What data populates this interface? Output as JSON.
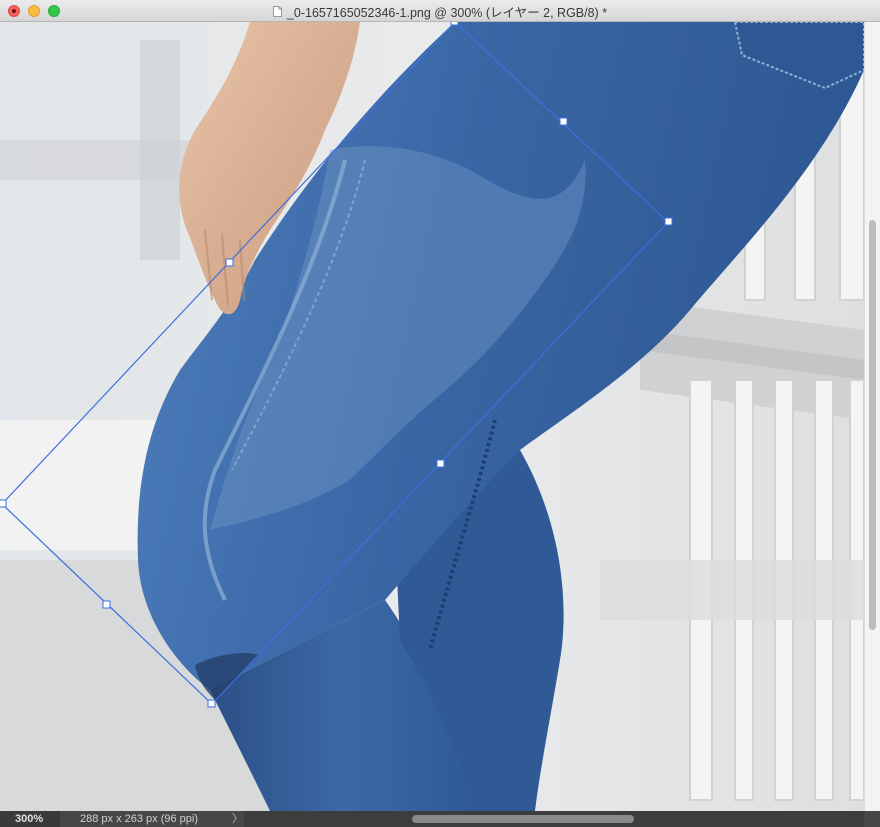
{
  "window": {
    "title": "_0-1657165052346-1.png @ 300% (レイヤー 2, RGB/8) *"
  },
  "status": {
    "zoom": "300%",
    "doc_info": "288 px x 263 px (96 ppi)",
    "chevron": "〉"
  },
  "colors": {
    "denim": "#3b6aa8",
    "denim_dark": "#2c5691",
    "transform_box": "#3d6fe0",
    "background": "#e3e4e4"
  },
  "icons": {
    "document": "doc-icon",
    "close": "close-icon",
    "minimize": "minimize-icon",
    "zoom": "zoom-icon"
  }
}
